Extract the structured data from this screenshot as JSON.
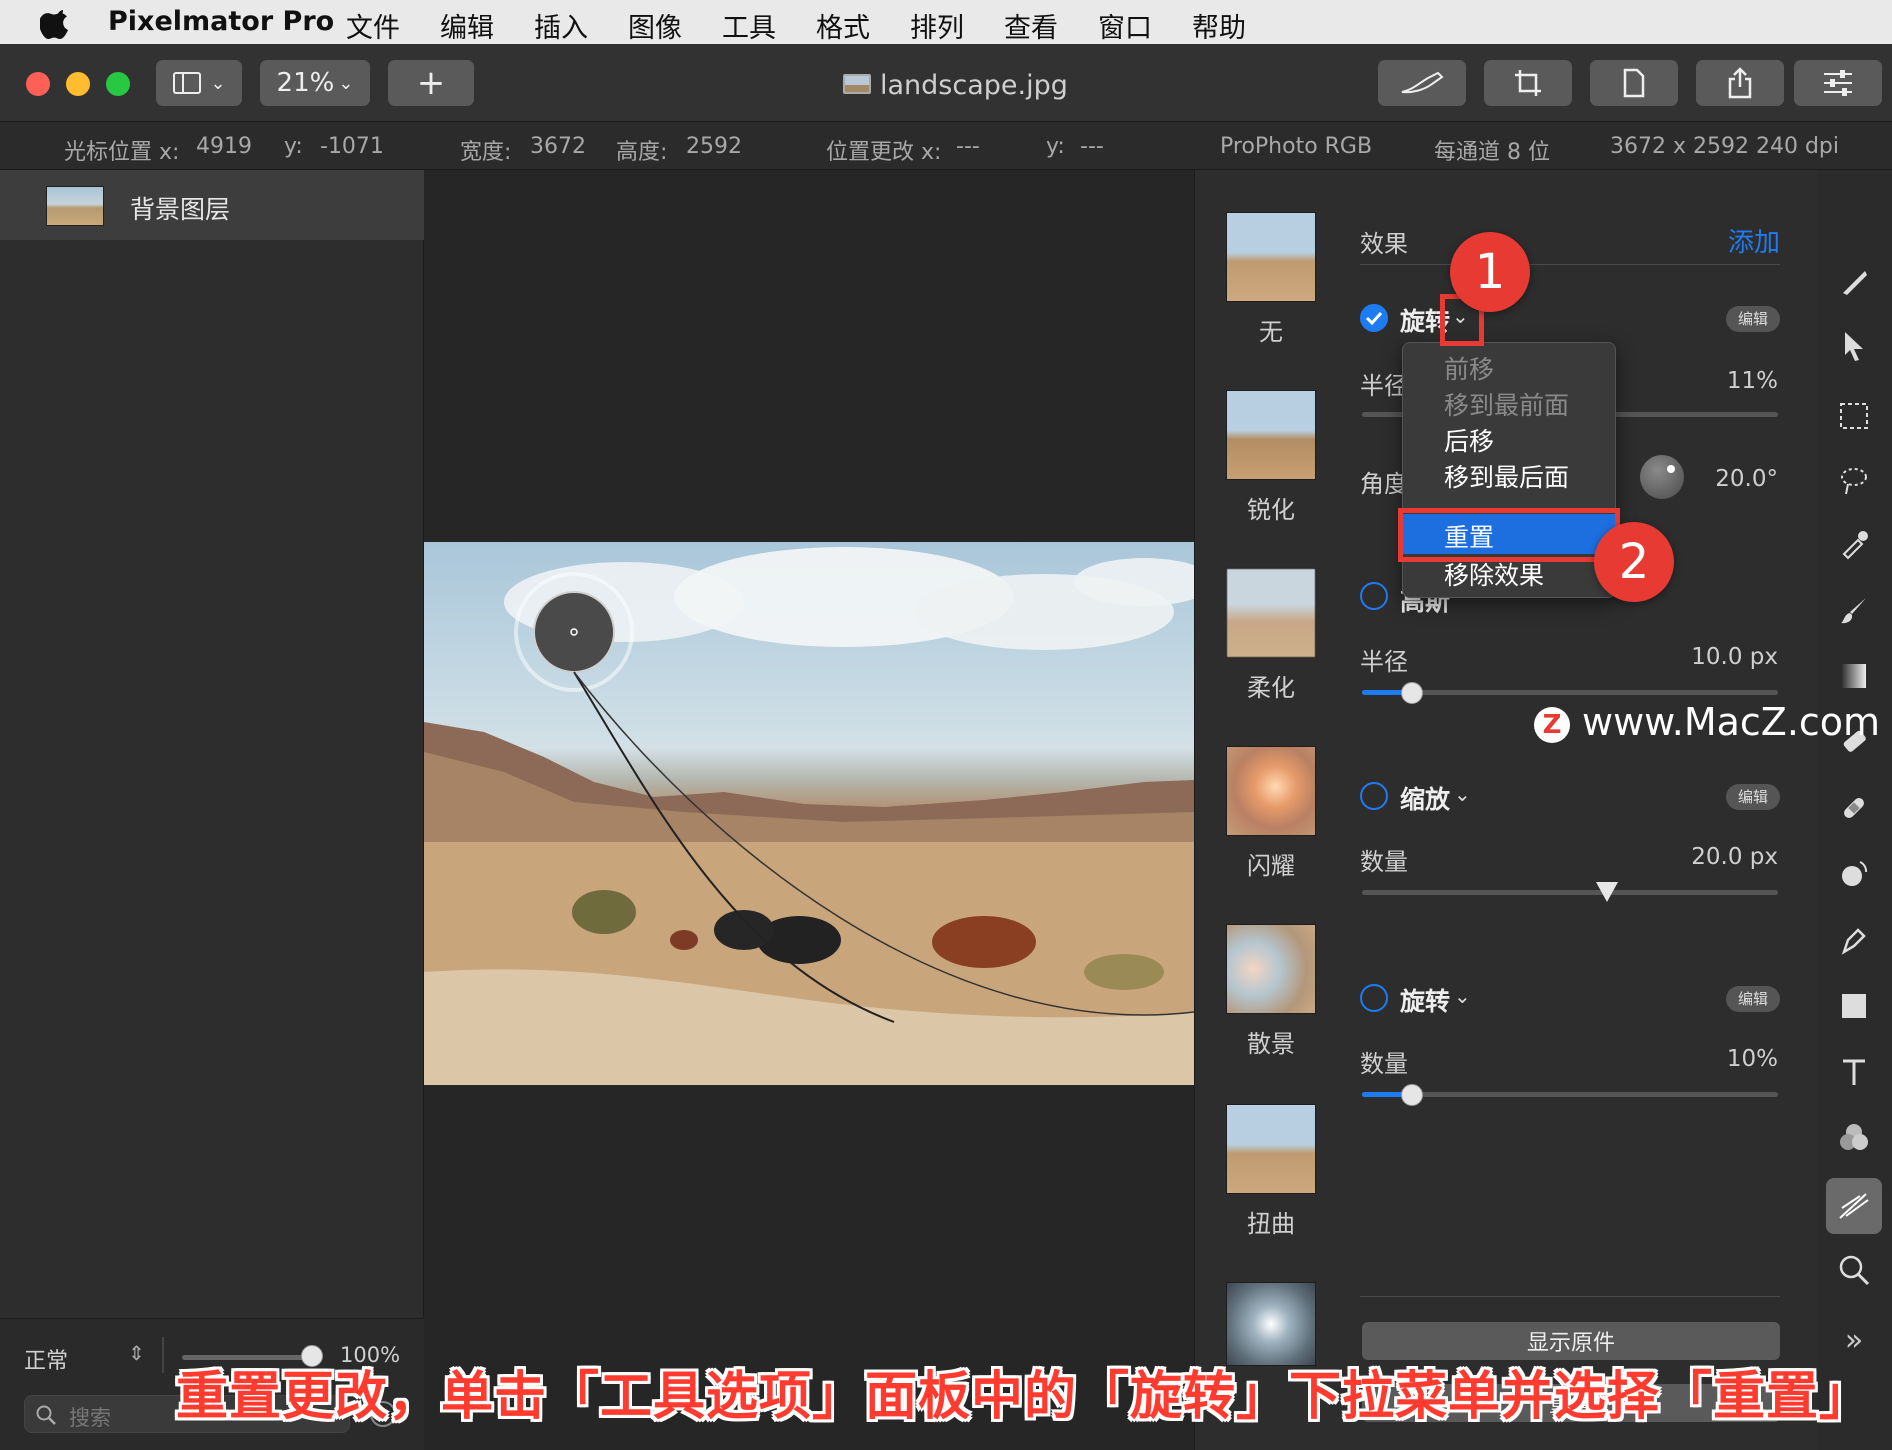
{
  "menubar": {
    "app_name": "Pixelmator Pro",
    "items": [
      "文件",
      "编辑",
      "插入",
      "图像",
      "工具",
      "格式",
      "排列",
      "查看",
      "窗口",
      "帮助"
    ]
  },
  "toolbar": {
    "zoom": "21%",
    "add_label": "+",
    "doc_title": "landscape.jpg"
  },
  "infobar": {
    "cursor_x_label": "光标位置 x:",
    "cursor_x": "4919",
    "cursor_y_label": "y:",
    "cursor_y": "-1071",
    "width_label": "宽度:",
    "width": "3672",
    "height_label": "高度:",
    "height": "2592",
    "pos_change_x_label": "位置更改 x:",
    "pos_change_x": "---",
    "pos_change_y_label": "y:",
    "pos_change_y": "---",
    "color_profile": "ProPhoto RGB",
    "bit_depth": "每通道 8 位",
    "dimensions": "3672 x 2592 240 dpi"
  },
  "layers": {
    "layer_name": "背景图层",
    "blend_mode": "正常",
    "opacity": "100%",
    "opacity_value": 1.0,
    "search_placeholder": "搜索"
  },
  "presets": [
    "无",
    "锐化",
    "柔化",
    "闪耀",
    "散景",
    "扭曲"
  ],
  "effects": {
    "header": "效果",
    "add": "添加",
    "edit_pill": "编辑",
    "twirl": {
      "name": "旋转",
      "radius_label": "半径",
      "radius_value": "11%",
      "angle_label": "角度",
      "angle_value": "20.0°"
    },
    "blur": {
      "name": "高斯",
      "radius_label": "半径",
      "radius_value": "10.0 px",
      "slider_fraction": 0.12
    },
    "zoom": {
      "name": "缩放",
      "amount_label": "数量",
      "amount_value": "20.0 px",
      "slider_fraction": 0.59
    },
    "twirl2": {
      "name": "旋转",
      "amount_label": "数量",
      "amount_value": "10%",
      "slider_fraction": 0.12
    },
    "show_original": "显示原件",
    "reset_button": "重置"
  },
  "menu": {
    "items": [
      "前移",
      "移到最前面",
      "后移",
      "移到最后面",
      "重置",
      "移除效果"
    ],
    "selected": "重置"
  },
  "annotations": {
    "callout_1": "1",
    "callout_2": "2",
    "caption": "重置更改，单击「工具选项」面板中的「旋转」下拉菜单并选择「重置」",
    "watermark": "www.MacZ.com",
    "watermark_logo": "Z"
  },
  "colors": {
    "accent": "#1e7cf2",
    "callout": "#e63a33",
    "caption": "#ff3b30"
  }
}
